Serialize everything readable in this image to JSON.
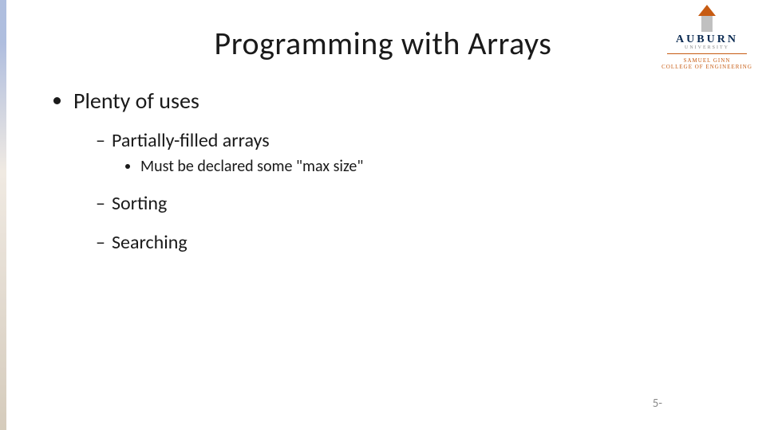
{
  "title": "Programming with Arrays",
  "bullets": {
    "l1": "Plenty of uses",
    "l2a": "Partially-filled arrays",
    "l3a": "Must be declared some \"max size\"",
    "l2b": "Sorting",
    "l2c": "Searching"
  },
  "page_number": "5-",
  "logo": {
    "name": "AUBURN",
    "sub": "UNIVERSITY",
    "college_line1": "SAMUEL GINN",
    "college_line2": "COLLEGE OF ENGINEERING"
  }
}
